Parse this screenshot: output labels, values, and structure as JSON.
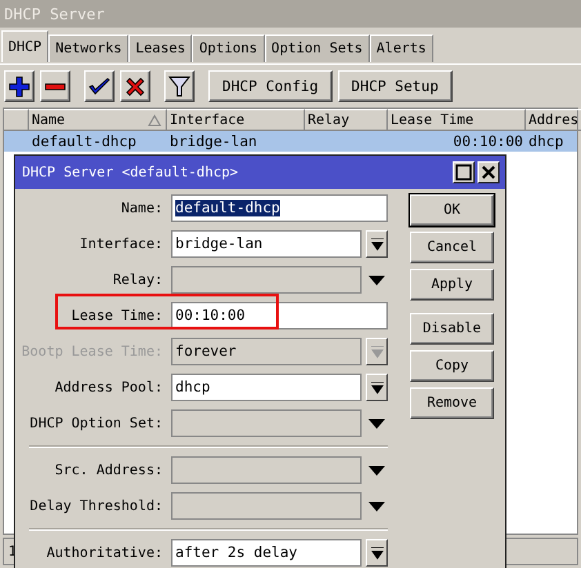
{
  "window": {
    "title": "DHCP Server"
  },
  "tabs": [
    {
      "label": "DHCP",
      "selected": true
    },
    {
      "label": "Networks",
      "selected": false
    },
    {
      "label": "Leases",
      "selected": false
    },
    {
      "label": "Options",
      "selected": false
    },
    {
      "label": "Option Sets",
      "selected": false
    },
    {
      "label": "Alerts",
      "selected": false
    }
  ],
  "toolbar": [
    [
      {
        "kind": "add"
      },
      {
        "kind": "remove"
      }
    ],
    [
      {
        "kind": "enable"
      },
      {
        "kind": "disable"
      }
    ],
    [
      {
        "kind": "filter"
      }
    ],
    [
      {
        "kind": "text",
        "label": "DHCP Config"
      },
      {
        "kind": "text",
        "label": "DHCP Setup"
      }
    ]
  ],
  "table": {
    "columns": [
      {},
      {
        "label": "Name",
        "sorted": true
      },
      {
        "label": "Interface"
      },
      {
        "label": "Relay"
      },
      {
        "label": "Lease Time"
      },
      {
        "label": "Addres"
      }
    ],
    "rows": [
      {
        "selected": true,
        "cells": [
          "",
          "default-dhcp",
          "bridge-lan",
          "",
          "00:10:00",
          "dhcp"
        ]
      }
    ]
  },
  "status_bar": {
    "count": "1"
  },
  "dialog": {
    "title": "DHCP Server <default-dhcp>",
    "field_groups": [
      [
        {
          "label": "Name:",
          "kind": "input",
          "value": "default-dhcp",
          "text_selected": true,
          "outlined": false,
          "disabled": false
        },
        {
          "label": "Interface:",
          "kind": "select",
          "value": "bridge-lan",
          "text_selected": false,
          "outlined": false,
          "disabled": false
        },
        {
          "label": "Relay:",
          "kind": "unset",
          "text_selected": false,
          "outlined": false,
          "disabled": false
        },
        {
          "label": "Lease Time:",
          "kind": "input",
          "value": "00:10:00",
          "text_selected": false,
          "outlined": true,
          "disabled": false
        },
        {
          "label": "Bootp Lease Time:",
          "kind": "select",
          "value": "forever",
          "text_selected": false,
          "outlined": false,
          "disabled": true
        },
        {
          "label": "Address Pool:",
          "kind": "select",
          "value": "dhcp",
          "text_selected": false,
          "outlined": false,
          "disabled": false
        },
        {
          "label": "DHCP Option Set:",
          "kind": "unset",
          "text_selected": false,
          "outlined": false,
          "disabled": false
        }
      ],
      [
        {
          "label": "Src. Address:",
          "kind": "unset",
          "text_selected": false,
          "outlined": false,
          "disabled": false
        },
        {
          "label": "Delay Threshold:",
          "kind": "unset",
          "text_selected": false,
          "outlined": false,
          "disabled": false
        }
      ],
      [
        {
          "label": "Authoritative:",
          "kind": "select",
          "value": "after 2s delay",
          "text_selected": false,
          "outlined": false,
          "disabled": false
        }
      ]
    ],
    "button_groups": [
      [
        {
          "label": "OK",
          "default": true
        },
        {
          "label": "Cancel",
          "default": false
        },
        {
          "label": "Apply",
          "default": false
        }
      ],
      [
        {
          "label": "Disable",
          "default": false
        },
        {
          "label": "Copy",
          "default": false
        },
        {
          "label": "Remove",
          "default": false
        }
      ]
    ]
  }
}
